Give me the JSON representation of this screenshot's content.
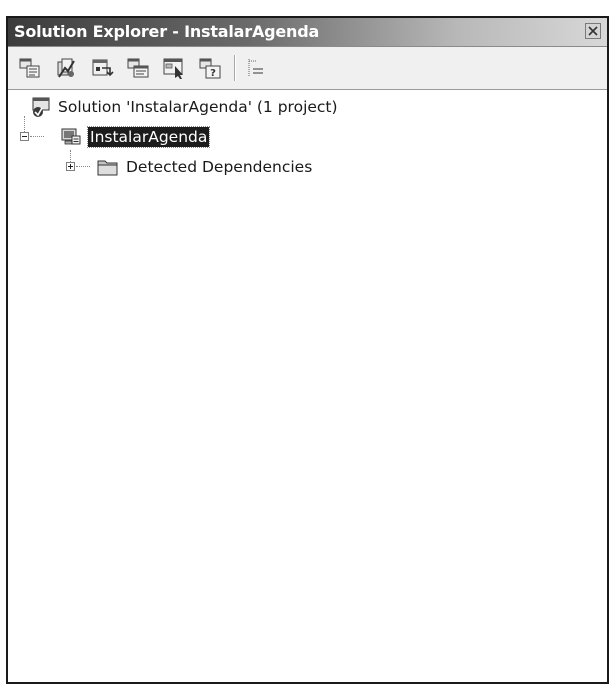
{
  "window": {
    "title": "Solution Explorer - InstalarAgenda",
    "close_icon": "close-icon"
  },
  "toolbar": {
    "buttons": [
      {
        "name": "properties-icon"
      },
      {
        "name": "show-all-files-icon"
      },
      {
        "name": "refresh-icon"
      },
      {
        "name": "view-code-icon"
      },
      {
        "name": "view-designer-icon"
      },
      {
        "name": "help-icon"
      },
      {
        "name": "class-view-icon"
      }
    ]
  },
  "tree": {
    "solution_label": "Solution 'InstalarAgenda' (1 project)",
    "project_label": "InstalarAgenda",
    "dependencies_label": "Detected Dependencies"
  },
  "colors": {
    "title_gradient_dark": "#3c3c3c",
    "title_gradient_light": "#d8d8d8",
    "selection": "#1c1c1c"
  }
}
